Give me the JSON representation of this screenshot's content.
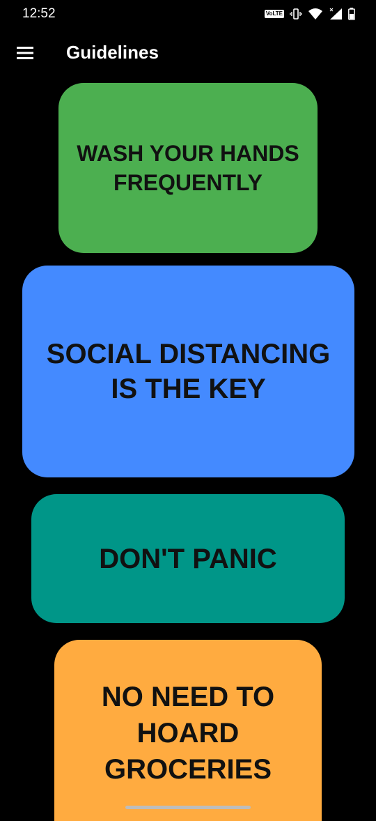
{
  "status_bar": {
    "time": "12:52",
    "volte": "VoLTE",
    "icons": [
      "volte-icon",
      "vibrate-icon",
      "wifi-icon",
      "signal-icon",
      "battery-icon"
    ]
  },
  "app_bar": {
    "menu_icon": "menu-icon",
    "title": "Guidelines"
  },
  "cards": [
    {
      "text": "WASH YOUR HANDS FREQUENTLY",
      "color": "#4CAF50"
    },
    {
      "text": "SOCIAL DISTANCING IS THE KEY",
      "color": "#448AFF"
    },
    {
      "text": "DON'T PANIC",
      "color": "#009688"
    },
    {
      "text": "NO NEED TO HOARD GROCERIES",
      "color": "#FFAB40"
    }
  ],
  "colors": {
    "background": "#000000",
    "text_on_card": "#111111",
    "title": "#FFFFFF"
  }
}
